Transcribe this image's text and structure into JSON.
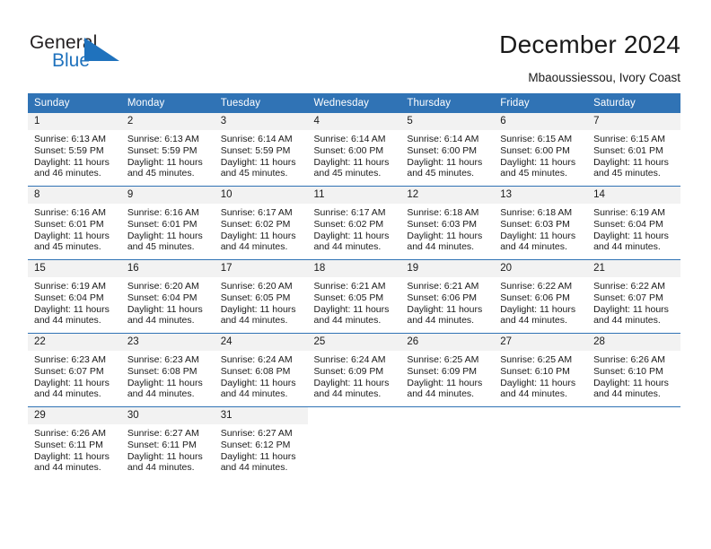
{
  "logo": {
    "word_top": "General",
    "word_bottom": "Blue",
    "flag_color": "#1f72bd",
    "text_color": "#231f20"
  },
  "header": {
    "title": "December 2024",
    "subtitle": "Mbaoussiessou, Ivory Coast"
  },
  "theme": {
    "header_blue": "#3073b5",
    "daynum_background": "#f2f2f2",
    "text": "#1a1a1a",
    "page_background": "#ffffff"
  },
  "calendar": {
    "weekday_headers": [
      "Sunday",
      "Monday",
      "Tuesday",
      "Wednesday",
      "Thursday",
      "Friday",
      "Saturday"
    ],
    "labels": {
      "sunrise": "Sunrise:",
      "sunset": "Sunset:",
      "daylight": "Daylight:"
    },
    "weeks": [
      [
        {
          "day": "1",
          "sunrise": "Sunrise: 6:13 AM",
          "sunset": "Sunset: 5:59 PM",
          "daylight_line1": "Daylight: 11 hours",
          "daylight_line2": "and 46 minutes."
        },
        {
          "day": "2",
          "sunrise": "Sunrise: 6:13 AM",
          "sunset": "Sunset: 5:59 PM",
          "daylight_line1": "Daylight: 11 hours",
          "daylight_line2": "and 45 minutes."
        },
        {
          "day": "3",
          "sunrise": "Sunrise: 6:14 AM",
          "sunset": "Sunset: 5:59 PM",
          "daylight_line1": "Daylight: 11 hours",
          "daylight_line2": "and 45 minutes."
        },
        {
          "day": "4",
          "sunrise": "Sunrise: 6:14 AM",
          "sunset": "Sunset: 6:00 PM",
          "daylight_line1": "Daylight: 11 hours",
          "daylight_line2": "and 45 minutes."
        },
        {
          "day": "5",
          "sunrise": "Sunrise: 6:14 AM",
          "sunset": "Sunset: 6:00 PM",
          "daylight_line1": "Daylight: 11 hours",
          "daylight_line2": "and 45 minutes."
        },
        {
          "day": "6",
          "sunrise": "Sunrise: 6:15 AM",
          "sunset": "Sunset: 6:00 PM",
          "daylight_line1": "Daylight: 11 hours",
          "daylight_line2": "and 45 minutes."
        },
        {
          "day": "7",
          "sunrise": "Sunrise: 6:15 AM",
          "sunset": "Sunset: 6:01 PM",
          "daylight_line1": "Daylight: 11 hours",
          "daylight_line2": "and 45 minutes."
        }
      ],
      [
        {
          "day": "8",
          "sunrise": "Sunrise: 6:16 AM",
          "sunset": "Sunset: 6:01 PM",
          "daylight_line1": "Daylight: 11 hours",
          "daylight_line2": "and 45 minutes."
        },
        {
          "day": "9",
          "sunrise": "Sunrise: 6:16 AM",
          "sunset": "Sunset: 6:01 PM",
          "daylight_line1": "Daylight: 11 hours",
          "daylight_line2": "and 45 minutes."
        },
        {
          "day": "10",
          "sunrise": "Sunrise: 6:17 AM",
          "sunset": "Sunset: 6:02 PM",
          "daylight_line1": "Daylight: 11 hours",
          "daylight_line2": "and 44 minutes."
        },
        {
          "day": "11",
          "sunrise": "Sunrise: 6:17 AM",
          "sunset": "Sunset: 6:02 PM",
          "daylight_line1": "Daylight: 11 hours",
          "daylight_line2": "and 44 minutes."
        },
        {
          "day": "12",
          "sunrise": "Sunrise: 6:18 AM",
          "sunset": "Sunset: 6:03 PM",
          "daylight_line1": "Daylight: 11 hours",
          "daylight_line2": "and 44 minutes."
        },
        {
          "day": "13",
          "sunrise": "Sunrise: 6:18 AM",
          "sunset": "Sunset: 6:03 PM",
          "daylight_line1": "Daylight: 11 hours",
          "daylight_line2": "and 44 minutes."
        },
        {
          "day": "14",
          "sunrise": "Sunrise: 6:19 AM",
          "sunset": "Sunset: 6:04 PM",
          "daylight_line1": "Daylight: 11 hours",
          "daylight_line2": "and 44 minutes."
        }
      ],
      [
        {
          "day": "15",
          "sunrise": "Sunrise: 6:19 AM",
          "sunset": "Sunset: 6:04 PM",
          "daylight_line1": "Daylight: 11 hours",
          "daylight_line2": "and 44 minutes."
        },
        {
          "day": "16",
          "sunrise": "Sunrise: 6:20 AM",
          "sunset": "Sunset: 6:04 PM",
          "daylight_line1": "Daylight: 11 hours",
          "daylight_line2": "and 44 minutes."
        },
        {
          "day": "17",
          "sunrise": "Sunrise: 6:20 AM",
          "sunset": "Sunset: 6:05 PM",
          "daylight_line1": "Daylight: 11 hours",
          "daylight_line2": "and 44 minutes."
        },
        {
          "day": "18",
          "sunrise": "Sunrise: 6:21 AM",
          "sunset": "Sunset: 6:05 PM",
          "daylight_line1": "Daylight: 11 hours",
          "daylight_line2": "and 44 minutes."
        },
        {
          "day": "19",
          "sunrise": "Sunrise: 6:21 AM",
          "sunset": "Sunset: 6:06 PM",
          "daylight_line1": "Daylight: 11 hours",
          "daylight_line2": "and 44 minutes."
        },
        {
          "day": "20",
          "sunrise": "Sunrise: 6:22 AM",
          "sunset": "Sunset: 6:06 PM",
          "daylight_line1": "Daylight: 11 hours",
          "daylight_line2": "and 44 minutes."
        },
        {
          "day": "21",
          "sunrise": "Sunrise: 6:22 AM",
          "sunset": "Sunset: 6:07 PM",
          "daylight_line1": "Daylight: 11 hours",
          "daylight_line2": "and 44 minutes."
        }
      ],
      [
        {
          "day": "22",
          "sunrise": "Sunrise: 6:23 AM",
          "sunset": "Sunset: 6:07 PM",
          "daylight_line1": "Daylight: 11 hours",
          "daylight_line2": "and 44 minutes."
        },
        {
          "day": "23",
          "sunrise": "Sunrise: 6:23 AM",
          "sunset": "Sunset: 6:08 PM",
          "daylight_line1": "Daylight: 11 hours",
          "daylight_line2": "and 44 minutes."
        },
        {
          "day": "24",
          "sunrise": "Sunrise: 6:24 AM",
          "sunset": "Sunset: 6:08 PM",
          "daylight_line1": "Daylight: 11 hours",
          "daylight_line2": "and 44 minutes."
        },
        {
          "day": "25",
          "sunrise": "Sunrise: 6:24 AM",
          "sunset": "Sunset: 6:09 PM",
          "daylight_line1": "Daylight: 11 hours",
          "daylight_line2": "and 44 minutes."
        },
        {
          "day": "26",
          "sunrise": "Sunrise: 6:25 AM",
          "sunset": "Sunset: 6:09 PM",
          "daylight_line1": "Daylight: 11 hours",
          "daylight_line2": "and 44 minutes."
        },
        {
          "day": "27",
          "sunrise": "Sunrise: 6:25 AM",
          "sunset": "Sunset: 6:10 PM",
          "daylight_line1": "Daylight: 11 hours",
          "daylight_line2": "and 44 minutes."
        },
        {
          "day": "28",
          "sunrise": "Sunrise: 6:26 AM",
          "sunset": "Sunset: 6:10 PM",
          "daylight_line1": "Daylight: 11 hours",
          "daylight_line2": "and 44 minutes."
        }
      ],
      [
        {
          "day": "29",
          "sunrise": "Sunrise: 6:26 AM",
          "sunset": "Sunset: 6:11 PM",
          "daylight_line1": "Daylight: 11 hours",
          "daylight_line2": "and 44 minutes."
        },
        {
          "day": "30",
          "sunrise": "Sunrise: 6:27 AM",
          "sunset": "Sunset: 6:11 PM",
          "daylight_line1": "Daylight: 11 hours",
          "daylight_line2": "and 44 minutes."
        },
        {
          "day": "31",
          "sunrise": "Sunrise: 6:27 AM",
          "sunset": "Sunset: 6:12 PM",
          "daylight_line1": "Daylight: 11 hours",
          "daylight_line2": "and 44 minutes."
        },
        {
          "day": "",
          "sunrise": "",
          "sunset": "",
          "daylight_line1": "",
          "daylight_line2": ""
        },
        {
          "day": "",
          "sunrise": "",
          "sunset": "",
          "daylight_line1": "",
          "daylight_line2": ""
        },
        {
          "day": "",
          "sunrise": "",
          "sunset": "",
          "daylight_line1": "",
          "daylight_line2": ""
        },
        {
          "day": "",
          "sunrise": "",
          "sunset": "",
          "daylight_line1": "",
          "daylight_line2": ""
        }
      ]
    ]
  }
}
